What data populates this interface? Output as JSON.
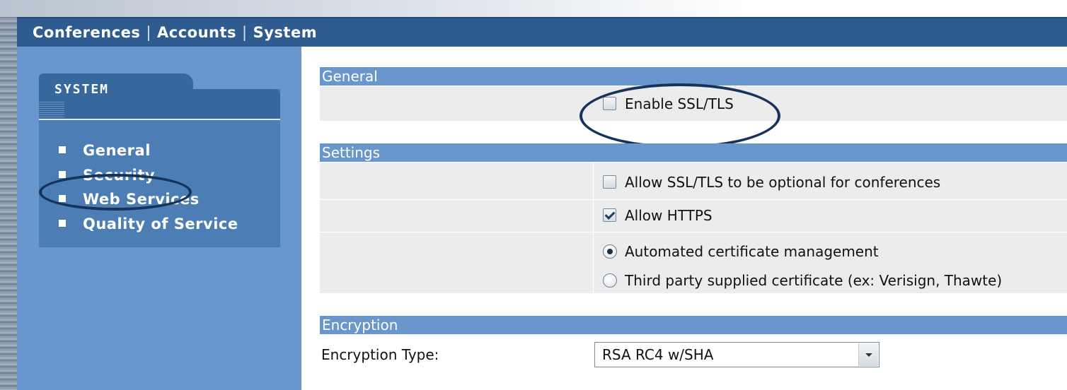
{
  "topnav": {
    "items": [
      "Conferences",
      "Accounts",
      "System"
    ],
    "separator": "|"
  },
  "sidebar": {
    "title": "SYSTEM",
    "items": [
      "General",
      "Security",
      "Web Services",
      "Quality of Service"
    ],
    "highlighted": "Security"
  },
  "sections": {
    "general": {
      "title": "General",
      "enable_ssl": {
        "label": "Enable SSL/TLS",
        "checked": false
      }
    },
    "settings": {
      "title": "Settings",
      "allow_optional": {
        "label": "Allow SSL/TLS to be optional for conferences",
        "checked": false
      },
      "allow_https": {
        "label": "Allow HTTPS",
        "checked": true
      },
      "cert_options": [
        {
          "label": "Automated certificate management",
          "selected": true
        },
        {
          "label": "Third party supplied certificate (ex: Verisign, Thawte)",
          "selected": false
        }
      ]
    },
    "encryption": {
      "title": "Encryption",
      "type_label": "Encryption Type:",
      "type_value": "RSA RC4 w/SHA"
    }
  },
  "colors": {
    "nav_bar": "#2e5c91",
    "sidebar_bg": "#6896cd",
    "section_header": "#6896cd",
    "row_bg": "#ececec",
    "highlight_ring": "#16335c"
  }
}
